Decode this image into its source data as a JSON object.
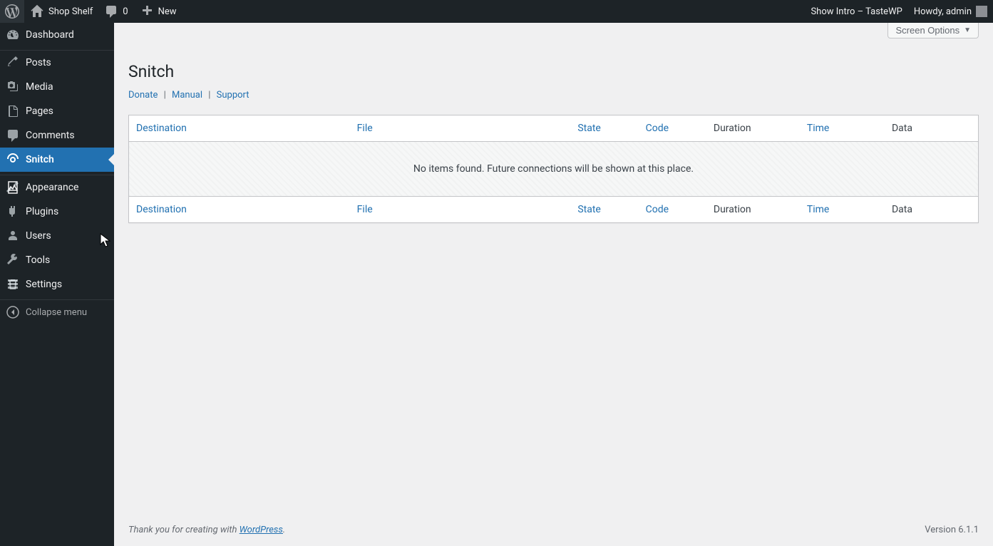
{
  "adminbar": {
    "site_name": "Shop Shelf",
    "comments_count": "0",
    "new_label": "New",
    "show_intro": "Show Intro – TasteWP",
    "howdy": "Howdy, admin"
  },
  "sidebar": {
    "items": [
      {
        "label": "Dashboard"
      },
      {
        "label": "Posts"
      },
      {
        "label": "Media"
      },
      {
        "label": "Pages"
      },
      {
        "label": "Comments"
      },
      {
        "label": "Snitch"
      },
      {
        "label": "Appearance"
      },
      {
        "label": "Plugins"
      },
      {
        "label": "Users"
      },
      {
        "label": "Tools"
      },
      {
        "label": "Settings"
      }
    ],
    "collapse_label": "Collapse menu"
  },
  "screen_options": "Screen Options",
  "page": {
    "title": "Snitch",
    "links": {
      "donate": "Donate",
      "manual": "Manual",
      "support": "Support"
    }
  },
  "table": {
    "columns": {
      "destination": "Destination",
      "file": "File",
      "state": "State",
      "code": "Code",
      "duration": "Duration",
      "time": "Time",
      "data": "Data"
    },
    "empty_message": "No items found. Future connections will be shown at this place."
  },
  "footer": {
    "thankyou_prefix": "Thank you for creating with ",
    "wordpress": "WordPress",
    "thankyou_suffix": ".",
    "version": "Version 6.1.1"
  }
}
